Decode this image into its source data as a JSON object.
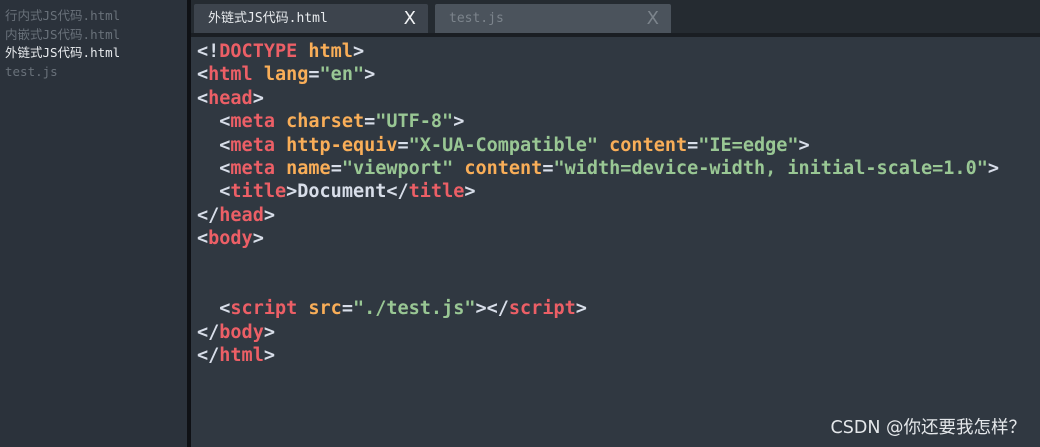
{
  "sidebar": {
    "files": [
      {
        "name": "行内式JS代码.html",
        "active": false
      },
      {
        "name": "内嵌式JS代码.html",
        "active": false
      },
      {
        "name": "外链式JS代码.html",
        "active": true
      },
      {
        "name": "test.js",
        "active": false
      }
    ]
  },
  "tabs": [
    {
      "label": "外链式JS代码.html",
      "close": "X",
      "active": true
    },
    {
      "label": "test.js",
      "close": "X",
      "active": false
    }
  ],
  "editor": {
    "lines": [
      [
        {
          "t": "<!",
          "c": "pu"
        },
        {
          "t": "DOCTYPE",
          "c": "tg"
        },
        {
          "t": " ",
          "c": "tx"
        },
        {
          "t": "html",
          "c": "at"
        },
        {
          "t": ">",
          "c": "pu"
        }
      ],
      [
        {
          "t": "<",
          "c": "pu"
        },
        {
          "t": "html",
          "c": "tg"
        },
        {
          "t": " ",
          "c": "tx"
        },
        {
          "t": "lang",
          "c": "at"
        },
        {
          "t": "=",
          "c": "pu"
        },
        {
          "t": "\"en\"",
          "c": "st"
        },
        {
          "t": ">",
          "c": "pu"
        }
      ],
      [
        {
          "t": "<",
          "c": "pu"
        },
        {
          "t": "head",
          "c": "tg"
        },
        {
          "t": ">",
          "c": "pu"
        }
      ],
      [
        {
          "t": "  <",
          "c": "pu"
        },
        {
          "t": "meta",
          "c": "tg"
        },
        {
          "t": " ",
          "c": "tx"
        },
        {
          "t": "charset",
          "c": "at"
        },
        {
          "t": "=",
          "c": "pu"
        },
        {
          "t": "\"UTF-8\"",
          "c": "st"
        },
        {
          "t": ">",
          "c": "pu"
        }
      ],
      [
        {
          "t": "  <",
          "c": "pu"
        },
        {
          "t": "meta",
          "c": "tg"
        },
        {
          "t": " ",
          "c": "tx"
        },
        {
          "t": "http-equiv",
          "c": "at"
        },
        {
          "t": "=",
          "c": "pu"
        },
        {
          "t": "\"X-UA-Compatible\"",
          "c": "st"
        },
        {
          "t": " ",
          "c": "tx"
        },
        {
          "t": "content",
          "c": "at"
        },
        {
          "t": "=",
          "c": "pu"
        },
        {
          "t": "\"IE=edge\"",
          "c": "st"
        },
        {
          "t": ">",
          "c": "pu"
        }
      ],
      [
        {
          "t": "  <",
          "c": "pu"
        },
        {
          "t": "meta",
          "c": "tg"
        },
        {
          "t": " ",
          "c": "tx"
        },
        {
          "t": "name",
          "c": "at"
        },
        {
          "t": "=",
          "c": "pu"
        },
        {
          "t": "\"viewport\"",
          "c": "st"
        },
        {
          "t": " ",
          "c": "tx"
        },
        {
          "t": "content",
          "c": "at"
        },
        {
          "t": "=",
          "c": "pu"
        },
        {
          "t": "\"width=device-width, initial-scale=1.0\"",
          "c": "st"
        },
        {
          "t": ">",
          "c": "pu"
        }
      ],
      [
        {
          "t": "  <",
          "c": "pu"
        },
        {
          "t": "title",
          "c": "tg"
        },
        {
          "t": ">",
          "c": "pu"
        },
        {
          "t": "Document",
          "c": "tx"
        },
        {
          "t": "</",
          "c": "pu"
        },
        {
          "t": "title",
          "c": "tg"
        },
        {
          "t": ">",
          "c": "pu"
        }
      ],
      [
        {
          "t": "</",
          "c": "pu"
        },
        {
          "t": "head",
          "c": "tg"
        },
        {
          "t": ">",
          "c": "pu"
        }
      ],
      [
        {
          "t": "<",
          "c": "pu"
        },
        {
          "t": "body",
          "c": "tg"
        },
        {
          "t": ">",
          "c": "pu"
        }
      ],
      [],
      [
        {
          "t": "  <",
          "c": "pu"
        },
        {
          "t": "script",
          "c": "tg"
        },
        {
          "t": " ",
          "c": "tx"
        },
        {
          "t": "src",
          "c": "at"
        },
        {
          "t": "=",
          "c": "pu"
        },
        {
          "t": "\"./test.js\"",
          "c": "st"
        },
        {
          "t": "></",
          "c": "pu"
        },
        {
          "t": "script",
          "c": "tg"
        },
        {
          "t": ">",
          "c": "pu"
        }
      ],
      [
        {
          "t": "</",
          "c": "pu"
        },
        {
          "t": "body",
          "c": "tg"
        },
        {
          "t": ">",
          "c": "pu"
        }
      ],
      [
        {
          "t": "</",
          "c": "pu"
        },
        {
          "t": "html",
          "c": "tg"
        },
        {
          "t": ">",
          "c": "pu"
        }
      ]
    ]
  },
  "watermark": "CSDN @你还要我怎样？"
}
